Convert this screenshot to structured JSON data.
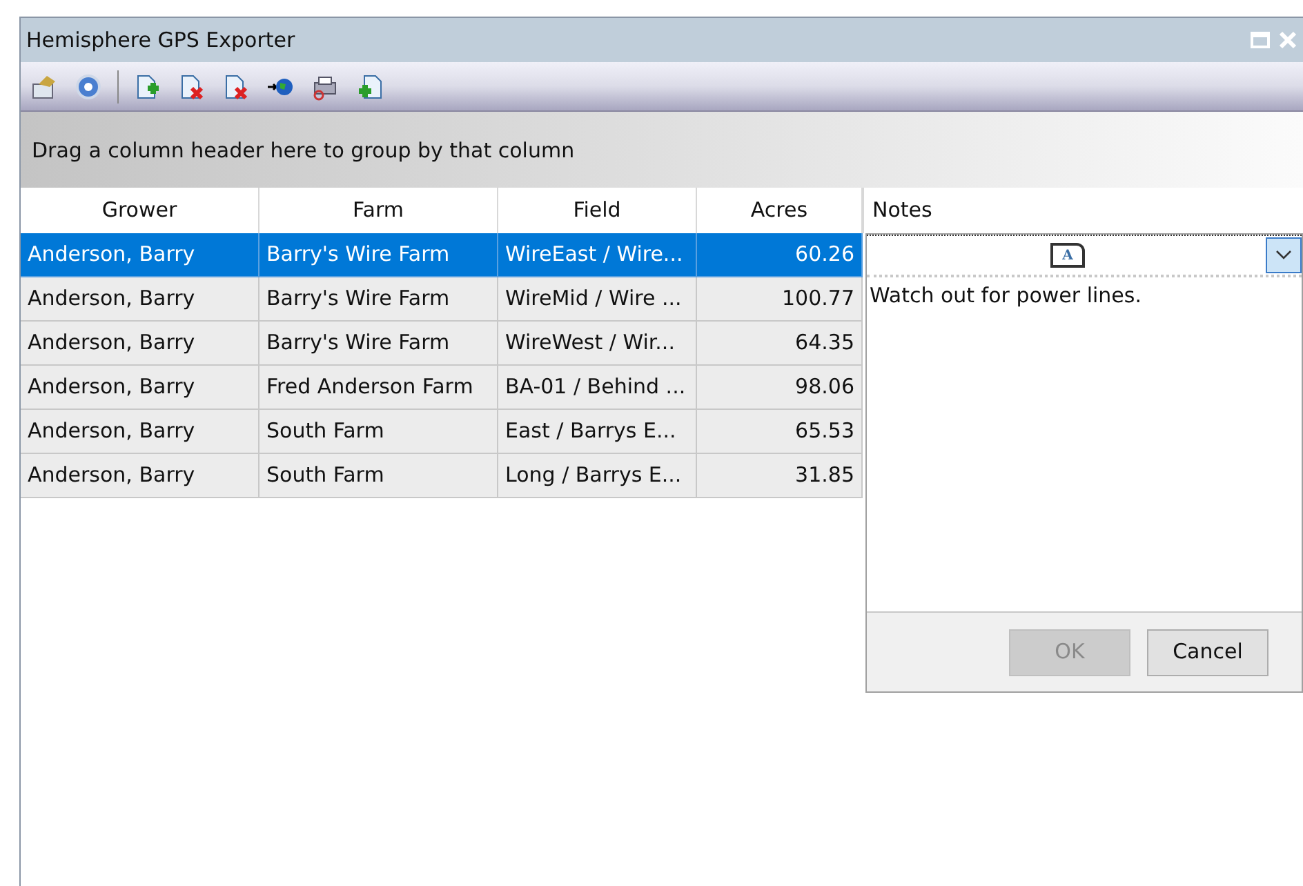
{
  "window": {
    "title": "Hemisphere GPS Exporter"
  },
  "group_panel": {
    "text": "Drag a column header here to group by that column"
  },
  "table": {
    "columns": [
      "Grower",
      "Farm",
      "Field",
      "Acres",
      "Notes"
    ],
    "rows": [
      {
        "grower": "Anderson, Barry",
        "farm": "Barry's Wire Farm",
        "field": "WireEast / Wire...",
        "acres": "60.26",
        "selected": true
      },
      {
        "grower": "Anderson, Barry",
        "farm": "Barry's Wire Farm",
        "field": "WireMid / Wire ...",
        "acres": "100.77",
        "selected": false
      },
      {
        "grower": "Anderson, Barry",
        "farm": "Barry's Wire Farm",
        "field": "WireWest / Wir...",
        "acres": "64.35",
        "selected": false
      },
      {
        "grower": "Anderson, Barry",
        "farm": "Fred Anderson Farm",
        "field": "BA-01 / Behind ...",
        "acres": "98.06",
        "selected": false
      },
      {
        "grower": "Anderson, Barry",
        "farm": "South Farm",
        "field": "East / Barrys E...",
        "acres": "65.53",
        "selected": false
      },
      {
        "grower": "Anderson, Barry",
        "farm": "South Farm",
        "field": "Long / Barrys E...",
        "acres": "31.85",
        "selected": false
      }
    ]
  },
  "notes_popup": {
    "icon_letter": "A",
    "text": "Watch out for power lines.",
    "buttons": [
      {
        "label": "OK",
        "disabled": true
      },
      {
        "label": "Cancel",
        "disabled": false
      }
    ]
  }
}
